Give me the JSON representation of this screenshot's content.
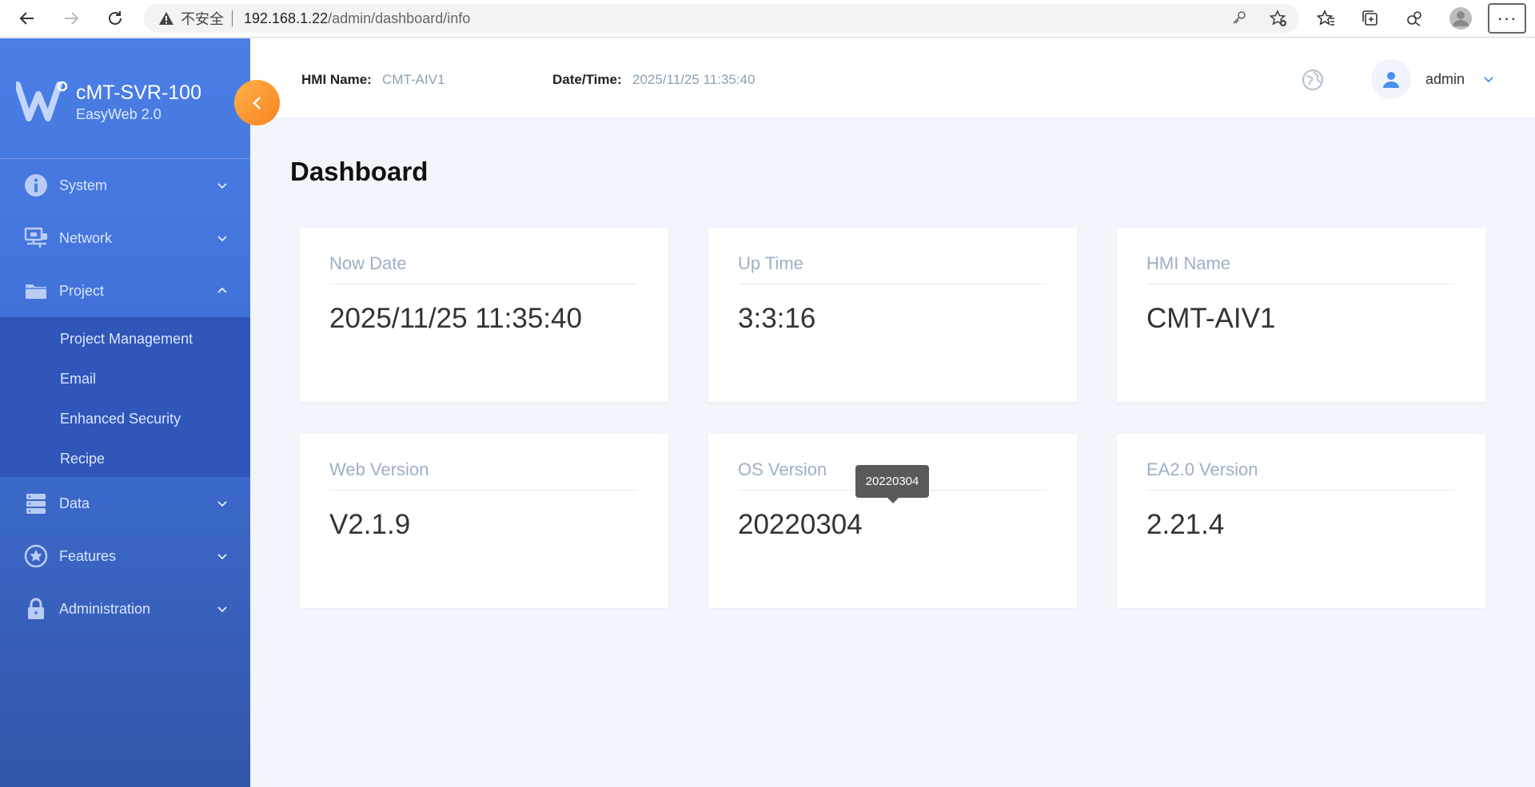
{
  "browser": {
    "insecure_label": "不安全",
    "url_host": "192.168.1.22",
    "url_path": "/admin/dashboard/info",
    "more_label": "···"
  },
  "brand": {
    "title": "cMT-SVR-100",
    "subtitle": "EasyWeb 2.0"
  },
  "sidebar": {
    "items": [
      {
        "label": "System",
        "icon": "info-icon",
        "expanded": false
      },
      {
        "label": "Network",
        "icon": "network-icon",
        "expanded": false
      },
      {
        "label": "Project",
        "icon": "folder-icon",
        "expanded": true
      },
      {
        "label": "Data",
        "icon": "database-icon",
        "expanded": false
      },
      {
        "label": "Features",
        "icon": "star-icon",
        "expanded": false
      },
      {
        "label": "Administration",
        "icon": "lock-icon",
        "expanded": false
      }
    ],
    "project_submenu": [
      "Project Management",
      "Email",
      "Enhanced Security",
      "Recipe"
    ]
  },
  "header": {
    "hmi_name_label": "HMI Name:",
    "hmi_name_value": "CMT-AIV1",
    "datetime_label": "Date/Time:",
    "datetime_value": "2025/11/25 11:35:40",
    "user": "admin"
  },
  "page": {
    "title": "Dashboard"
  },
  "cards": [
    {
      "label": "Now Date",
      "value": "2025/11/25 11:35:40"
    },
    {
      "label": "Up Time",
      "value": "3:3:16"
    },
    {
      "label": "HMI Name",
      "value": "CMT-AIV1"
    },
    {
      "label": "Web Version",
      "value": "V2.1.9"
    },
    {
      "label": "OS Version",
      "value": "20220304"
    },
    {
      "label": "EA2.0 Version",
      "value": "2.21.4"
    }
  ],
  "tooltip": {
    "text": "20220304"
  },
  "colors": {
    "sidebar_top": "#4b7fe6",
    "sidebar_bottom": "#3256a8",
    "submenu_bg": "#2f56b8",
    "accent_orange": "#f8841f",
    "content_bg": "#f2f6fc"
  }
}
